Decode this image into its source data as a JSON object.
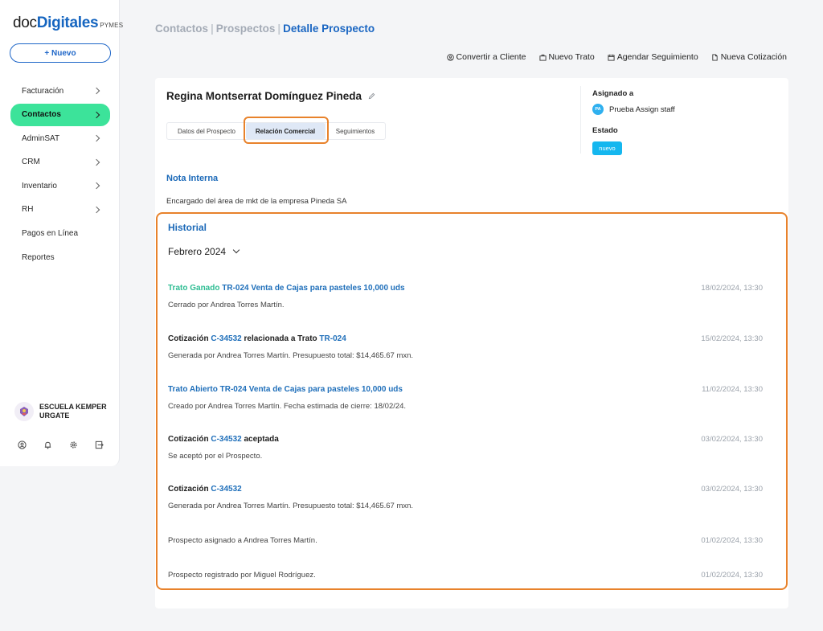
{
  "logo": {
    "part1": "doc",
    "part2": "Digitales",
    "part3": "PYMES"
  },
  "sidebar": {
    "new_button": "+ Nuevo",
    "items": [
      {
        "label": "Facturación",
        "has_chevron": true
      },
      {
        "label": "Contactos",
        "has_chevron": true,
        "active": true
      },
      {
        "label": "AdminSAT",
        "has_chevron": true
      },
      {
        "label": "CRM",
        "has_chevron": true
      },
      {
        "label": "Inventario",
        "has_chevron": true
      },
      {
        "label": "RH",
        "has_chevron": true
      },
      {
        "label": "Pagos en Línea",
        "has_chevron": false
      },
      {
        "label": "Reportes",
        "has_chevron": false
      }
    ],
    "school_name": "ESCUELA KEMPER URGATE",
    "bottom_icons": [
      "user-circle-icon",
      "bell-icon",
      "gear-icon",
      "logout-icon"
    ]
  },
  "breadcrumb": {
    "item1": "Contactos",
    "item2": "Prospectos",
    "item3": "Detalle Prospecto",
    "sep": "|"
  },
  "actions": {
    "convert": "Convertir a Cliente",
    "new_deal": "Nuevo Trato",
    "schedule": "Agendar Seguimiento",
    "quote": "Nueva Cotización"
  },
  "prospect": {
    "name": "Regina Montserrat Domínguez Pineda",
    "tabs": [
      "Datos del Prospecto",
      "Relación Comercial",
      "Seguimientos"
    ],
    "active_tab": "Relación Comercial",
    "assigned_label": "Asignado a",
    "assignee_initials": "PA",
    "assignee_name": "Prueba Assign staff",
    "status_label": "Estado",
    "status": "nuevo",
    "note_title": "Nota Interna",
    "note_text": "Encargado del área de mkt de la empresa Pineda SA"
  },
  "historial": {
    "title": "Historial",
    "month": "Febrero 2024",
    "entries": [
      {
        "t1": "Trato Ganado",
        "t2": "TR-024 Venta de Cajas para pasteles 10,000 uds",
        "sub": "Cerrado por Andrea Torres Martín.",
        "date": "18/02/2024, 13:30"
      },
      {
        "t1": "Cotización",
        "t2": "C-34532",
        "t3": "relacionada a Trato",
        "t4": "TR-024",
        "sub": "Generada por Andrea Torres Martín. Presupuesto total: $14,465.67 mxn.",
        "date": "15/02/2024, 13:30"
      },
      {
        "t1": "Trato Abierto",
        "t2": "TR-024 Venta de Cajas para pasteles 10,000 uds",
        "sub": "Creado por Andrea Torres Martín. Fecha estimada de cierre: 18/02/24.",
        "date": "11/02/2024, 13:30"
      },
      {
        "t1": "Cotización",
        "t2": "C-34532",
        "t3": "aceptada",
        "sub": "Se aceptó por el Prospecto.",
        "date": "03/02/2024, 13:30"
      },
      {
        "t1": "Cotización",
        "t2": "C-34532",
        "sub": "Generada por Andrea Torres Martín. Presupuesto total: $14,465.67 mxn.",
        "date": "03/02/2024, 13:30"
      },
      {
        "text": "Prospecto asignado a Andrea Torres Martín.",
        "date": "01/02/2024, 13:30"
      },
      {
        "text": "Prospecto registrado por Miguel Rodríguez.",
        "date": "01/02/2024, 13:30"
      }
    ]
  },
  "colors": {
    "accent_green": "#3ce39a",
    "brand_blue": "#1565c0",
    "highlight_orange": "#e8822b",
    "status_cyan": "#15b7ef"
  }
}
